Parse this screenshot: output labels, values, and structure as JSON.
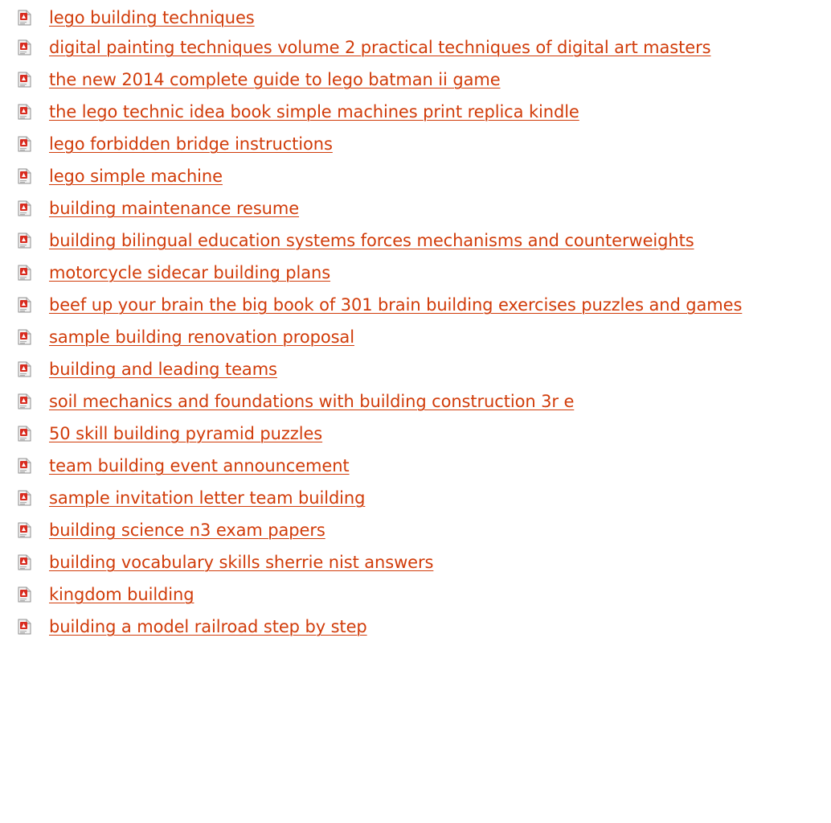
{
  "colors": {
    "link": "#d13c0a",
    "icon_red": "#d92b1f"
  },
  "icon": "pdf-file-icon",
  "items": [
    {
      "label": "lego building techniques"
    },
    {
      "label": "digital painting techniques volume 2 practical techniques of digital art masters"
    },
    {
      "label": "the new 2014 complete guide to lego batman ii game"
    },
    {
      "label": "the lego technic idea book simple machines print replica kindle"
    },
    {
      "label": "lego forbidden bridge instructions"
    },
    {
      "label": "lego simple machine"
    },
    {
      "label": "building maintenance resume"
    },
    {
      "label": "building bilingual education systems forces mechanisms and counterweights"
    },
    {
      "label": "motorcycle sidecar building plans"
    },
    {
      "label": "beef up your brain the big book of 301 brain building exercises puzzles and games"
    },
    {
      "label": "sample building renovation proposal"
    },
    {
      "label": "building and leading teams"
    },
    {
      "label": "soil mechanics and foundations with building construction 3r e"
    },
    {
      "label": "50 skill building pyramid puzzles"
    },
    {
      "label": "team building event announcement"
    },
    {
      "label": "sample invitation letter team building"
    },
    {
      "label": "building science n3 exam papers"
    },
    {
      "label": "building vocabulary skills sherrie nist answers"
    },
    {
      "label": "kingdom building"
    },
    {
      "label": "building a model railroad step by step"
    }
  ]
}
